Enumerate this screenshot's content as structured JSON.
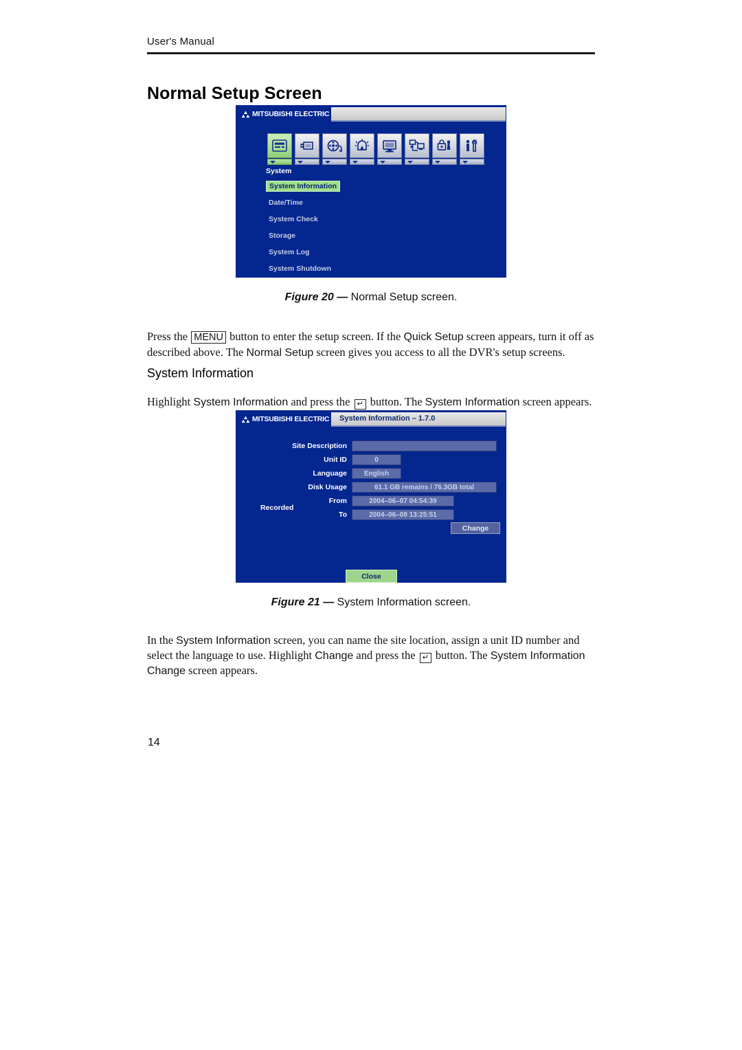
{
  "document": {
    "running_head": "User's Manual",
    "page_number": "14",
    "title": "Normal Setup Screen"
  },
  "figures": [
    {
      "caption_label": "Figure 20 —",
      "caption_text": "Normal Setup screen."
    },
    {
      "caption_label": "Figure 21 —",
      "caption_text": "System Information screen."
    }
  ],
  "paragraphs": {
    "intro": {
      "seg1": "Press the ",
      "key1": "MENU",
      "seg2": " button to enter the setup screen.  If the ",
      "ui1": "Quick Setup",
      "seg3": " screen appears, turn it off as described above.  The ",
      "ui2": "Normal Setup",
      "seg4": " screen gives you access to all the DVR's setup screens."
    },
    "sysinfo_intro": {
      "seg1": "Highlight ",
      "ui1": "System Information",
      "seg2": " and press the ",
      "key1": "↵",
      "seg3": " button.  The ",
      "ui2": "System Information",
      "seg4": " screen appears."
    },
    "sysinfo_body": {
      "seg1": "In the ",
      "ui1": "System Information",
      "seg2": " screen, you can name the site location, assign a unit ID number and select the language to use.  Highlight ",
      "ui2": "Change",
      "seg3": " and press the ",
      "key1": "↵",
      "seg4": " button.  The ",
      "ui3": "System Information Change",
      "seg5": " screen appears."
    }
  },
  "headings": {
    "system_information": "System Information"
  },
  "setup_screen": {
    "brand": "MITSUBISHI ELECTRIC",
    "title_bar_text": "",
    "toolbar": [
      {
        "name": "system",
        "icon": "dvr-icon",
        "selected": true
      },
      {
        "name": "camera",
        "icon": "camera-icon",
        "selected": false
      },
      {
        "name": "record",
        "icon": "film-reel-icon",
        "selected": false
      },
      {
        "name": "event",
        "icon": "alarm-icon",
        "selected": false
      },
      {
        "name": "display",
        "icon": "monitor-icon",
        "selected": false
      },
      {
        "name": "network",
        "icon": "network-icon",
        "selected": false
      },
      {
        "name": "security",
        "icon": "lock-icon",
        "selected": false
      },
      {
        "name": "config",
        "icon": "tools-icon",
        "selected": false
      }
    ],
    "group_label": "System",
    "menu_items": [
      {
        "label": "System Information",
        "highlighted": true
      },
      {
        "label": "Date/Time",
        "highlighted": false
      },
      {
        "label": "System Check",
        "highlighted": false
      },
      {
        "label": "Storage",
        "highlighted": false
      },
      {
        "label": "System Log",
        "highlighted": false
      },
      {
        "label": "System Shutdown",
        "highlighted": false
      }
    ]
  },
  "sysinfo_screen": {
    "brand": "MITSUBISHI ELECTRIC",
    "title_bar_text": "System Information –  1.7.0",
    "fields": {
      "site_description_label": "Site Description",
      "site_description_value": "",
      "unit_id_label": "Unit ID",
      "unit_id_value": "0",
      "language_label": "Language",
      "language_value": "English",
      "disk_usage_label": "Disk Usage",
      "disk_usage_value": "61.1 GB remains / 76.3GB total",
      "recorded_label": "Recorded",
      "recorded_from_label": "From",
      "recorded_from_value": "2004–06–07 04:54:39",
      "recorded_to_label": "To",
      "recorded_to_value": "2004–06–08 13:25:51"
    },
    "buttons": {
      "change": "Change",
      "close": "Close"
    }
  },
  "colors": {
    "screen_blue": "#04268f",
    "highlight_green": "#9fe08a",
    "field_blue": "#5b6ba8"
  }
}
